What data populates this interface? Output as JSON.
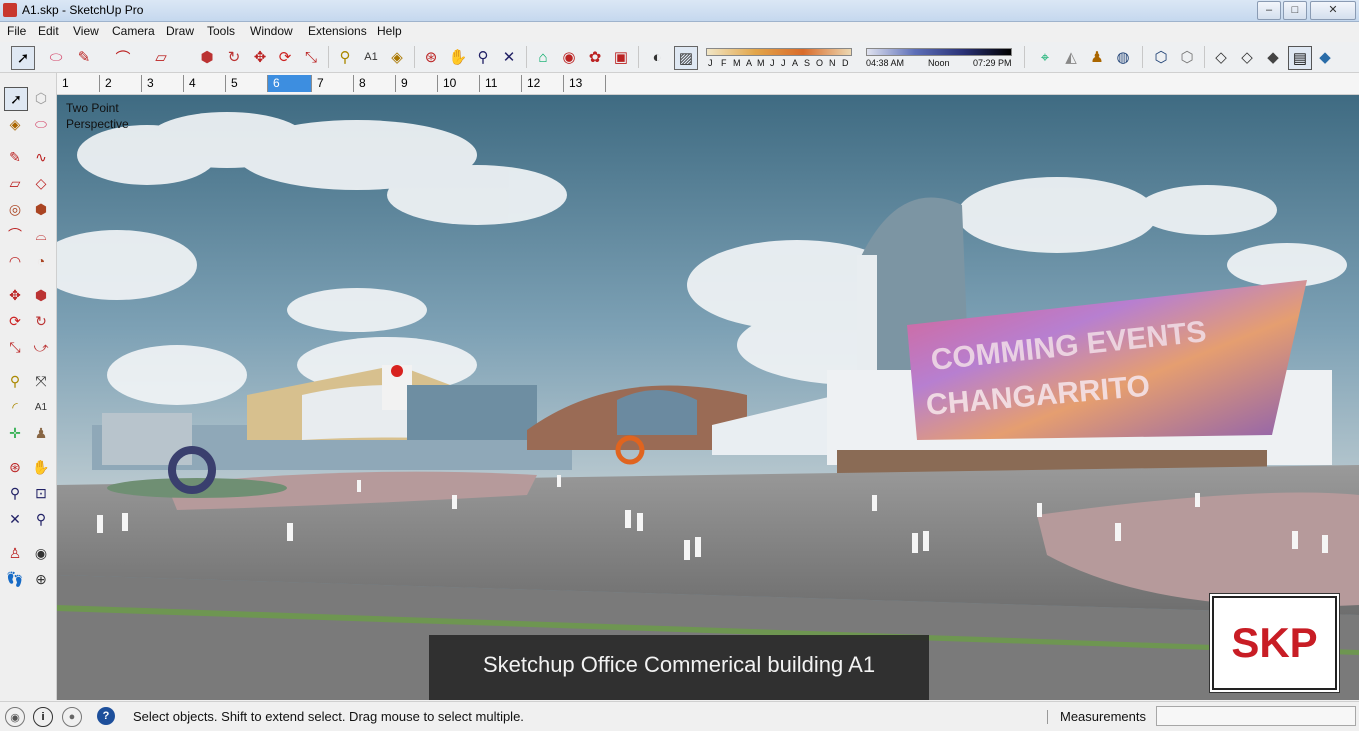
{
  "window": {
    "title": "A1.skp - SketchUp Pro"
  },
  "menus": [
    "File",
    "Edit",
    "View",
    "Camera",
    "Draw",
    "Tools",
    "Window",
    "Extensions",
    "Help"
  ],
  "shadows": {
    "months": [
      "J",
      "F",
      "M",
      "A",
      "M",
      "J",
      "J",
      "A",
      "S",
      "O",
      "N",
      "D"
    ],
    "times": [
      "04:38 AM",
      "Noon",
      "07:29 PM"
    ]
  },
  "scenes": [
    "1",
    "2",
    "3",
    "4",
    "5",
    "6",
    "7",
    "8",
    "9",
    "10",
    "11",
    "12",
    "13"
  ],
  "active_scene": "6",
  "viewport": {
    "view_label_line1": "Two Point",
    "view_label_line2": "Perspective",
    "caption": "Sketchup Office Commerical building A1",
    "badge": "SKP",
    "billboard_line1": "COMMING EVENTS",
    "billboard_line2": "CHANGARRITO"
  },
  "status": {
    "hint": "Select objects. Shift to extend select. Drag mouse to select multiple.",
    "measurements_label": "Measurements",
    "measurements_value": ""
  },
  "colors": {
    "active_scene": "#3d8ee0",
    "brand_red": "#c81d25"
  }
}
